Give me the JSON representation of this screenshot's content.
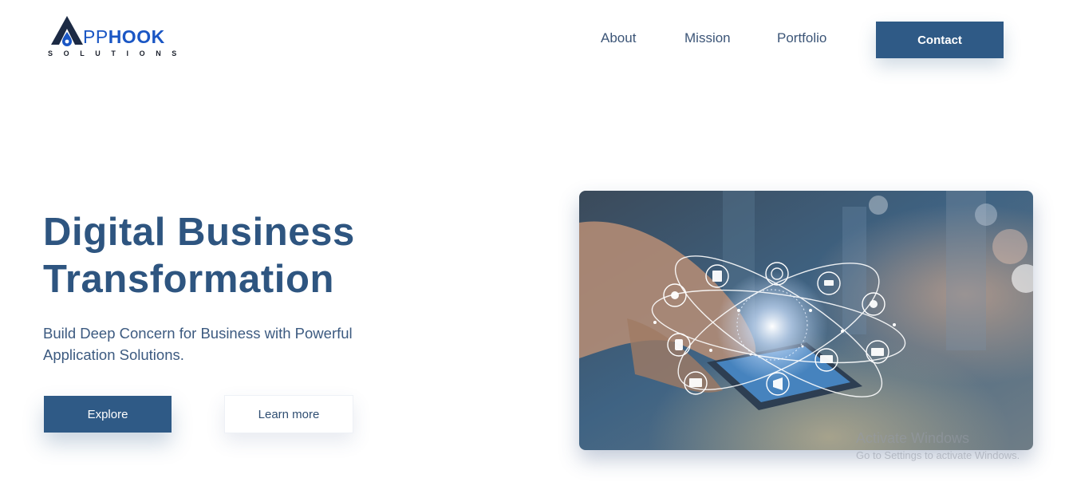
{
  "brand": {
    "logo_a": "A",
    "logo_pp": "PP",
    "logo_hook": "HOOK",
    "logo_sub": "SOLUTIONS",
    "accent": "#1a56c4"
  },
  "nav": {
    "links": [
      "About",
      "Mission",
      "Portfolio"
    ],
    "contact_label": "Contact"
  },
  "hero": {
    "title": "Digital Business Transformation",
    "subtitle": "Build Deep Concern for Business with Powerful Application Solutions.",
    "explore_label": "Explore",
    "learn_label": "Learn more",
    "image_icons": [
      "document-icon",
      "globe-icon",
      "cart-icon",
      "headset-icon",
      "mail-icon",
      "laptop-icon",
      "megaphone-icon",
      "monitor-icon",
      "phone-icon",
      "support-icon"
    ]
  },
  "watermark": {
    "line1": "Activate Windows",
    "line2": "Go to Settings to activate Windows."
  },
  "colors": {
    "primary": "#2f5a86",
    "heading": "#2e5580",
    "text": "#3c5a80"
  }
}
